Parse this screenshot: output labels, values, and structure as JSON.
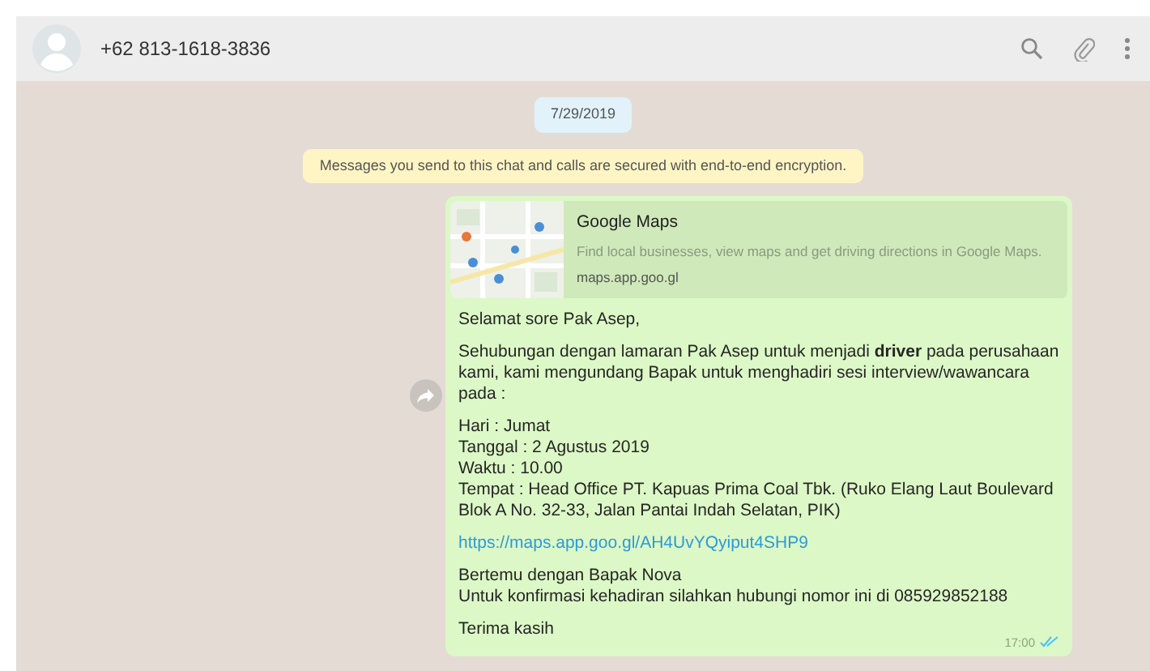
{
  "header": {
    "contact_name": "+62 813-1618-3836"
  },
  "date_chip": "7/29/2019",
  "encryption_notice": "Messages you send to this chat and calls are secured with end-to-end encryption.",
  "message": {
    "link_preview": {
      "title": "Google Maps",
      "description": "Find local businesses, view maps and get driving directions in Google Maps.",
      "url": "maps.app.goo.gl"
    },
    "paragraphs": [
      {
        "kind": "text",
        "lines": [
          "Selamat sore Pak Asep,"
        ]
      },
      {
        "kind": "text",
        "lines": [
          "Sehubungan dengan lamaran Pak Asep untuk menjadi **driver** pada perusahaan kami, kami mengundang Bapak untuk menghadiri sesi interview/wawancara pada :"
        ]
      },
      {
        "kind": "text",
        "lines": [
          "Hari : Jumat",
          "Tanggal : 2 Agustus 2019",
          "Waktu : 10.00",
          "Tempat : Head Office PT. Kapuas Prima Coal Tbk. (Ruko Elang Laut Boulevard Blok A No. 32-33, Jalan Pantai Indah Selatan, PIK)"
        ]
      },
      {
        "kind": "link",
        "lines": [
          "https://maps.app.goo.gl/AH4UvYQyiput4SHP9"
        ]
      },
      {
        "kind": "text",
        "lines": [
          "Bertemu dengan Bapak Nova",
          "Untuk konfirmasi kehadiran silahkan hubungi nomor ini di 085929852188"
        ]
      },
      {
        "kind": "text",
        "lines": [
          "Terima kasih"
        ]
      }
    ],
    "time": "17:00",
    "read": true
  }
}
